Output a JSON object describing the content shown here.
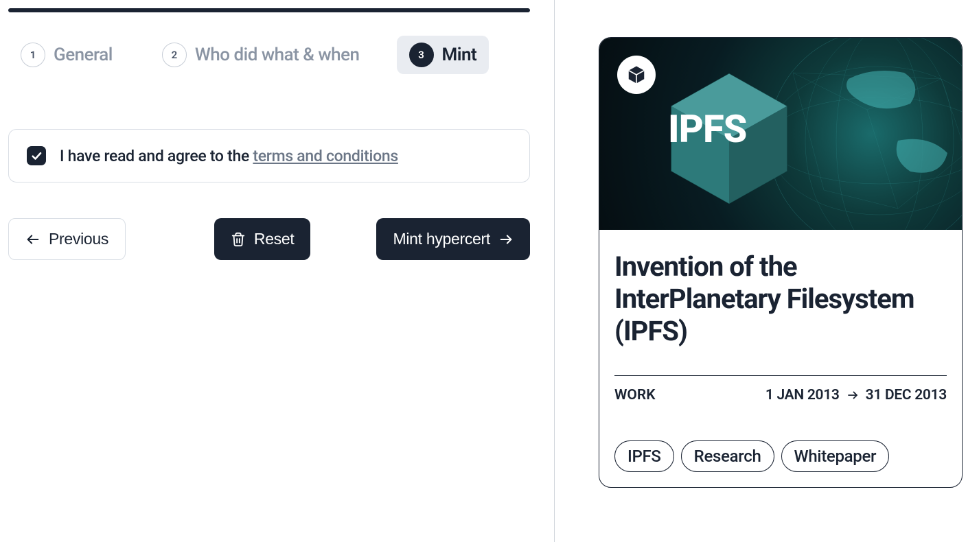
{
  "stepper": {
    "steps": [
      {
        "num": "1",
        "label": "General"
      },
      {
        "num": "2",
        "label": "Who did what & when"
      },
      {
        "num": "3",
        "label": "Mint"
      }
    ],
    "activeIndex": 2
  },
  "consent": {
    "prefix": "I have read and agree to the ",
    "link": "terms and conditions",
    "checked": true
  },
  "actions": {
    "previous": "Previous",
    "reset": "Reset",
    "mint": "Mint hypercert"
  },
  "preview": {
    "headerLogo": "IPFS",
    "title": "Invention of the InterPlanetary Filesystem (IPFS)",
    "workLabel": "WORK",
    "dateFrom": "1 JAN 2013",
    "dateTo": "31 DEC 2013",
    "tags": [
      "IPFS",
      "Research",
      "Whitepaper"
    ]
  }
}
